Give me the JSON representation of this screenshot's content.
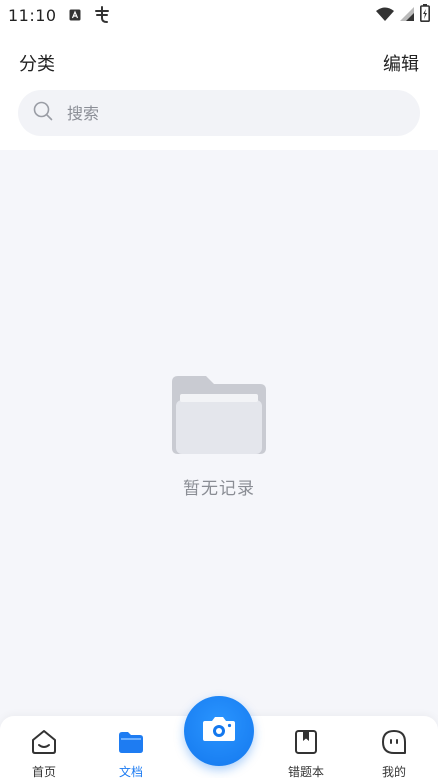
{
  "status_bar": {
    "time": "11:10"
  },
  "header": {
    "category_label": "分类",
    "edit_label": "编辑"
  },
  "search": {
    "placeholder": "搜索"
  },
  "empty_state": {
    "message": "暂无记录"
  },
  "tabs": [
    {
      "label": "首页",
      "icon": "home-face-icon",
      "active": false
    },
    {
      "label": "文档",
      "icon": "folder-icon",
      "active": true
    },
    {
      "label": "错题本",
      "icon": "bookmark-book-icon",
      "active": false
    },
    {
      "label": "我的",
      "icon": "profile-face-icon",
      "active": false
    }
  ],
  "camera_button": {
    "icon": "camera-icon"
  },
  "colors": {
    "accent": "#1e7cf2",
    "background": "#f5f6fa",
    "inactive_text": "#333333"
  }
}
